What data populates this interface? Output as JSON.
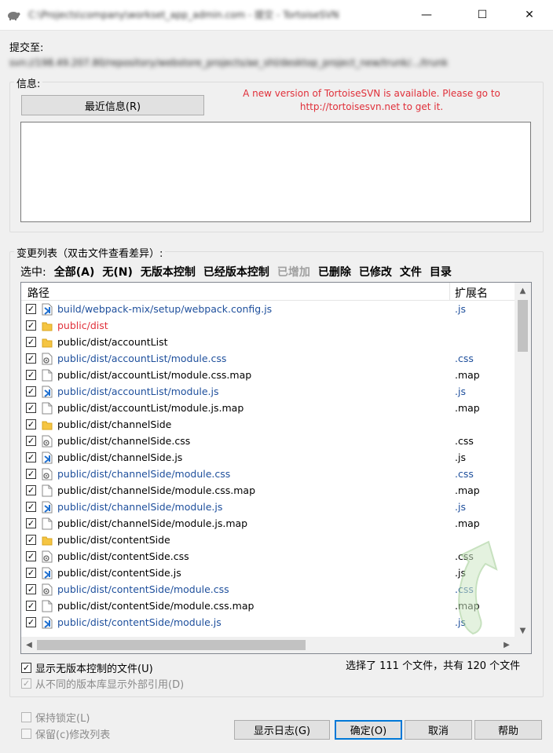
{
  "window": {
    "title": "C:\\Projects\\company\\workset_app_admin.com - 提交 - TortoiseSVN",
    "minimize": "—",
    "maximize": "☐",
    "close": "✕"
  },
  "commit_to": {
    "label": "提交至:",
    "url": "svn://198.49.207.80/repository/webstore_projects/ae_shl/desktop_project_new/trunk/.../trunk"
  },
  "message": {
    "legend": "信息:",
    "recent_button": "最近信息(R)",
    "notice_line1": "A new version of TortoiseSVN is available. Please go to",
    "notice_line2": "http://tortoisesvn.net to get it.",
    "text": ""
  },
  "changes": {
    "legend": "变更列表（双击文件查看差异）:",
    "select_label": "选中:",
    "filters": [
      {
        "label": "全部(A)",
        "enabled": true
      },
      {
        "label": "无(N)",
        "enabled": true
      },
      {
        "label": "无版本控制",
        "enabled": true
      },
      {
        "label": "已经版本控制",
        "enabled": true
      },
      {
        "label": "已增加",
        "enabled": false
      },
      {
        "label": "已删除",
        "enabled": true
      },
      {
        "label": "已修改",
        "enabled": true
      },
      {
        "label": "文件",
        "enabled": true
      },
      {
        "label": "目录",
        "enabled": true
      }
    ],
    "columns": {
      "path": "路径",
      "ext": "扩展名"
    },
    "rows": [
      {
        "path": "build/webpack-mix/setup/webpack.config.js",
        "ext": ".js",
        "icon": "js-file-icon",
        "status": "added"
      },
      {
        "path": "public/dist",
        "ext": "",
        "icon": "folder-icon",
        "status": "missing"
      },
      {
        "path": "public/dist/accountList",
        "ext": "",
        "icon": "folder-icon",
        "status": "normal"
      },
      {
        "path": "public/dist/accountList/module.css",
        "ext": ".css",
        "icon": "css-file-icon",
        "status": "added"
      },
      {
        "path": "public/dist/accountList/module.css.map",
        "ext": ".map",
        "icon": "file-icon",
        "status": "normal"
      },
      {
        "path": "public/dist/accountList/module.js",
        "ext": ".js",
        "icon": "js-file-icon",
        "status": "added"
      },
      {
        "path": "public/dist/accountList/module.js.map",
        "ext": ".map",
        "icon": "file-icon",
        "status": "normal"
      },
      {
        "path": "public/dist/channelSide",
        "ext": "",
        "icon": "folder-icon",
        "status": "normal"
      },
      {
        "path": "public/dist/channelSide.css",
        "ext": ".css",
        "icon": "css-file-icon",
        "status": "normal"
      },
      {
        "path": "public/dist/channelSide.js",
        "ext": ".js",
        "icon": "js-file-icon",
        "status": "normal"
      },
      {
        "path": "public/dist/channelSide/module.css",
        "ext": ".css",
        "icon": "css-file-icon",
        "status": "added"
      },
      {
        "path": "public/dist/channelSide/module.css.map",
        "ext": ".map",
        "icon": "file-icon",
        "status": "normal"
      },
      {
        "path": "public/dist/channelSide/module.js",
        "ext": ".js",
        "icon": "js-file-icon",
        "status": "added"
      },
      {
        "path": "public/dist/channelSide/module.js.map",
        "ext": ".map",
        "icon": "file-icon",
        "status": "normal"
      },
      {
        "path": "public/dist/contentSide",
        "ext": "",
        "icon": "folder-icon",
        "status": "normal"
      },
      {
        "path": "public/dist/contentSide.css",
        "ext": ".css",
        "icon": "css-file-icon",
        "status": "normal"
      },
      {
        "path": "public/dist/contentSide.js",
        "ext": ".js",
        "icon": "js-file-icon",
        "status": "normal"
      },
      {
        "path": "public/dist/contentSide/module.css",
        "ext": ".css",
        "icon": "css-file-icon",
        "status": "added"
      },
      {
        "path": "public/dist/contentSide/module.css.map",
        "ext": ".map",
        "icon": "file-icon",
        "status": "normal"
      },
      {
        "path": "public/dist/contentSide/module.js",
        "ext": ".js",
        "icon": "js-file-icon",
        "status": "added"
      }
    ],
    "show_unversioned": "显示无版本控制的文件(U)",
    "show_externals": "从不同的版本库显示外部引用(D)",
    "status_text": "选择了 111 个文件，共有 120 个文件"
  },
  "options": {
    "keep_locks": "保持锁定(L)",
    "keep_changelists": "保留(c)修改列表"
  },
  "buttons": {
    "show_log": "显示日志(G)",
    "ok": "确定(O)",
    "cancel": "取消",
    "help": "帮助"
  },
  "colors": {
    "accent": "#0078d7",
    "added": "#1e4f9c",
    "missing": "#e0303a",
    "notice": "#e0303a"
  }
}
